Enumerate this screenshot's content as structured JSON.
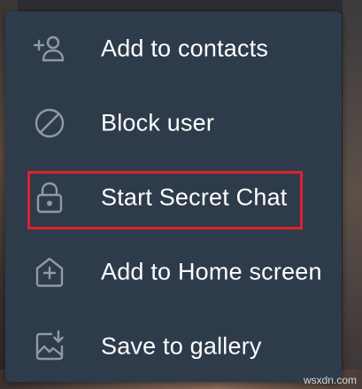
{
  "menu": {
    "items": [
      {
        "label": "Add to contacts",
        "icon": "add-contact-icon"
      },
      {
        "label": "Block user",
        "icon": "block-icon"
      },
      {
        "label": "Start Secret Chat",
        "icon": "lock-icon"
      },
      {
        "label": "Add to Home screen",
        "icon": "add-home-icon"
      },
      {
        "label": "Save to gallery",
        "icon": "save-gallery-icon"
      }
    ]
  },
  "colors": {
    "menu_background": "#2e3b4b",
    "icon_color": "#8e9aa8",
    "text_color": "#ffffff",
    "highlight_border": "#e0202a"
  },
  "watermark": "wsxdn.com"
}
